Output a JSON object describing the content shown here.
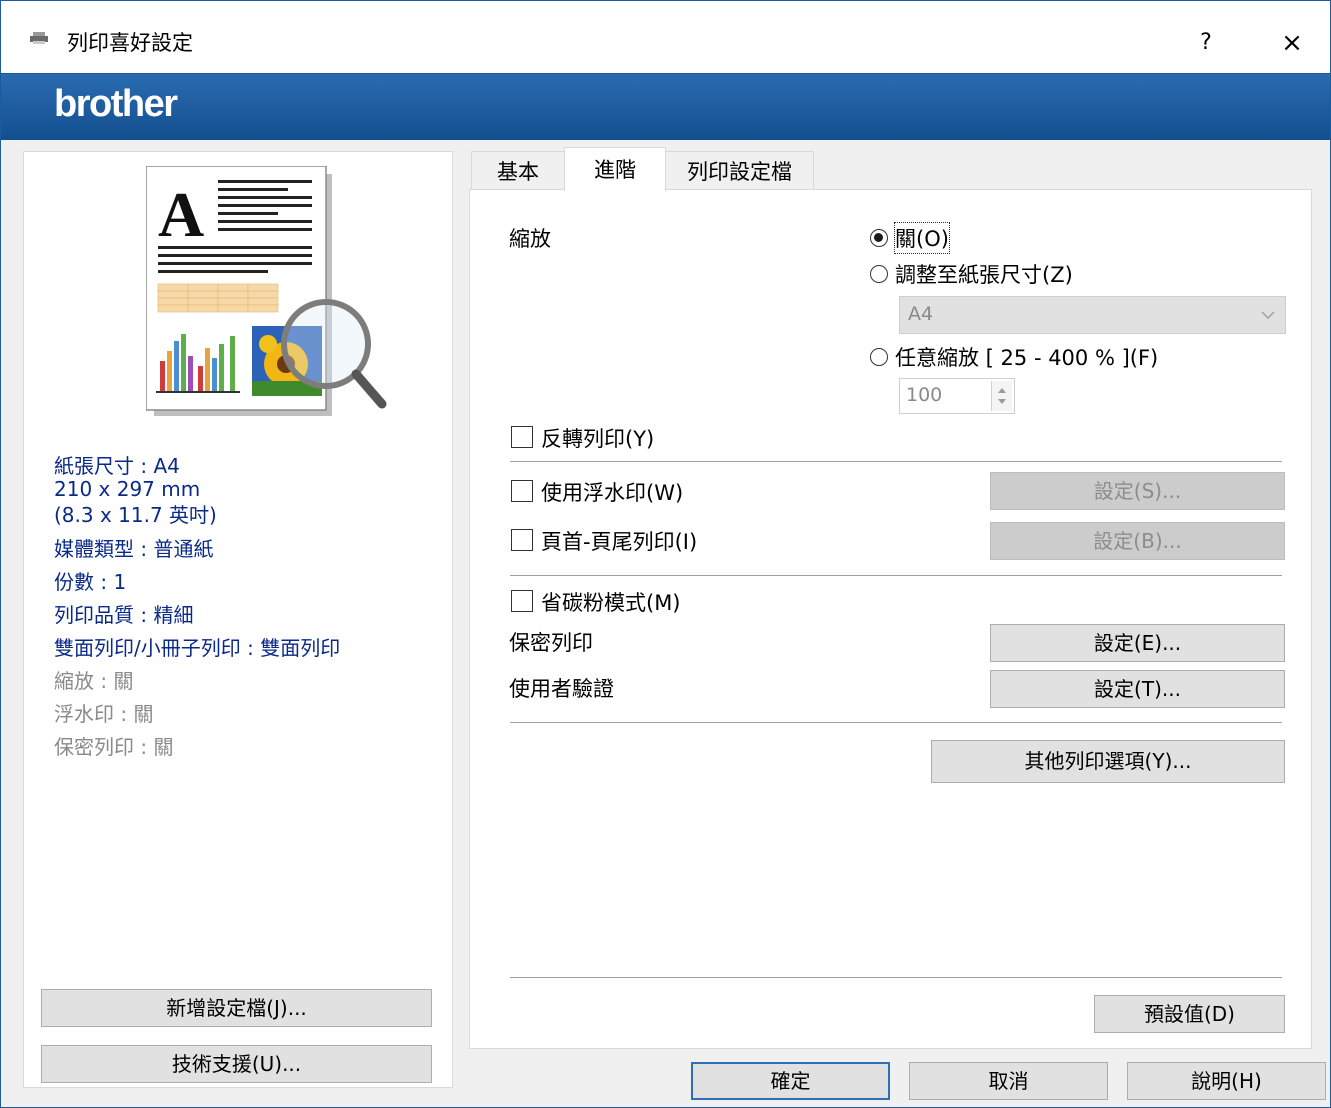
{
  "window": {
    "title": "列印喜好設定",
    "help_label": "?",
    "close_label": "×",
    "brand": "brother"
  },
  "summary": {
    "paper_size": "紙張尺寸 : A4",
    "paper_mm": "210 x 297 mm",
    "paper_inch": "(8.3 x 11.7 英吋)",
    "media_type": "媒體類型 : 普通紙",
    "copies": "份數 : 1",
    "quality": "列印品質 : 精細",
    "duplex": "雙面列印/小冊子列印 : 雙面列印",
    "scaling": "縮放 : 關",
    "watermark": "浮水印 : 關",
    "secure_print": "保密列印 : 關"
  },
  "left_buttons": {
    "add_profile": "新增設定檔(J)...",
    "support": "技術支援(U)..."
  },
  "tabs": [
    {
      "label": "基本"
    },
    {
      "label": "進階"
    },
    {
      "label": "列印設定檔"
    }
  ],
  "advanced": {
    "scaling_label": "縮放",
    "scaling_off": "關(O)",
    "fit_to_paper": "調整至紙張尺寸(Z)",
    "paper_select_value": "A4",
    "free_scaling": "任意縮放 [ 25 - 400 % ](F)",
    "free_scaling_value": "100",
    "mirror_print": "反轉列印(Y)",
    "use_watermark": "使用浮水印(W)",
    "watermark_settings": "設定(S)...",
    "header_footer": "頁首-頁尾列印(I)",
    "header_footer_settings": "設定(B)...",
    "toner_save": "省碳粉模式(M)",
    "secure_print_label": "保密列印",
    "secure_print_settings": "設定(E)...",
    "user_auth_label": "使用者驗證",
    "user_auth_settings": "設定(T)...",
    "other_options": "其他列印選項(Y)...",
    "default": "預設值(D)"
  },
  "footer": {
    "ok": "確定",
    "cancel": "取消",
    "help": "說明(H)"
  },
  "colors": {
    "brand_bar": "#1d5d9f",
    "window_border": "#1c5a9e",
    "summary_text": "#0a2a8a",
    "disabled_text": "#8a8a8a"
  }
}
